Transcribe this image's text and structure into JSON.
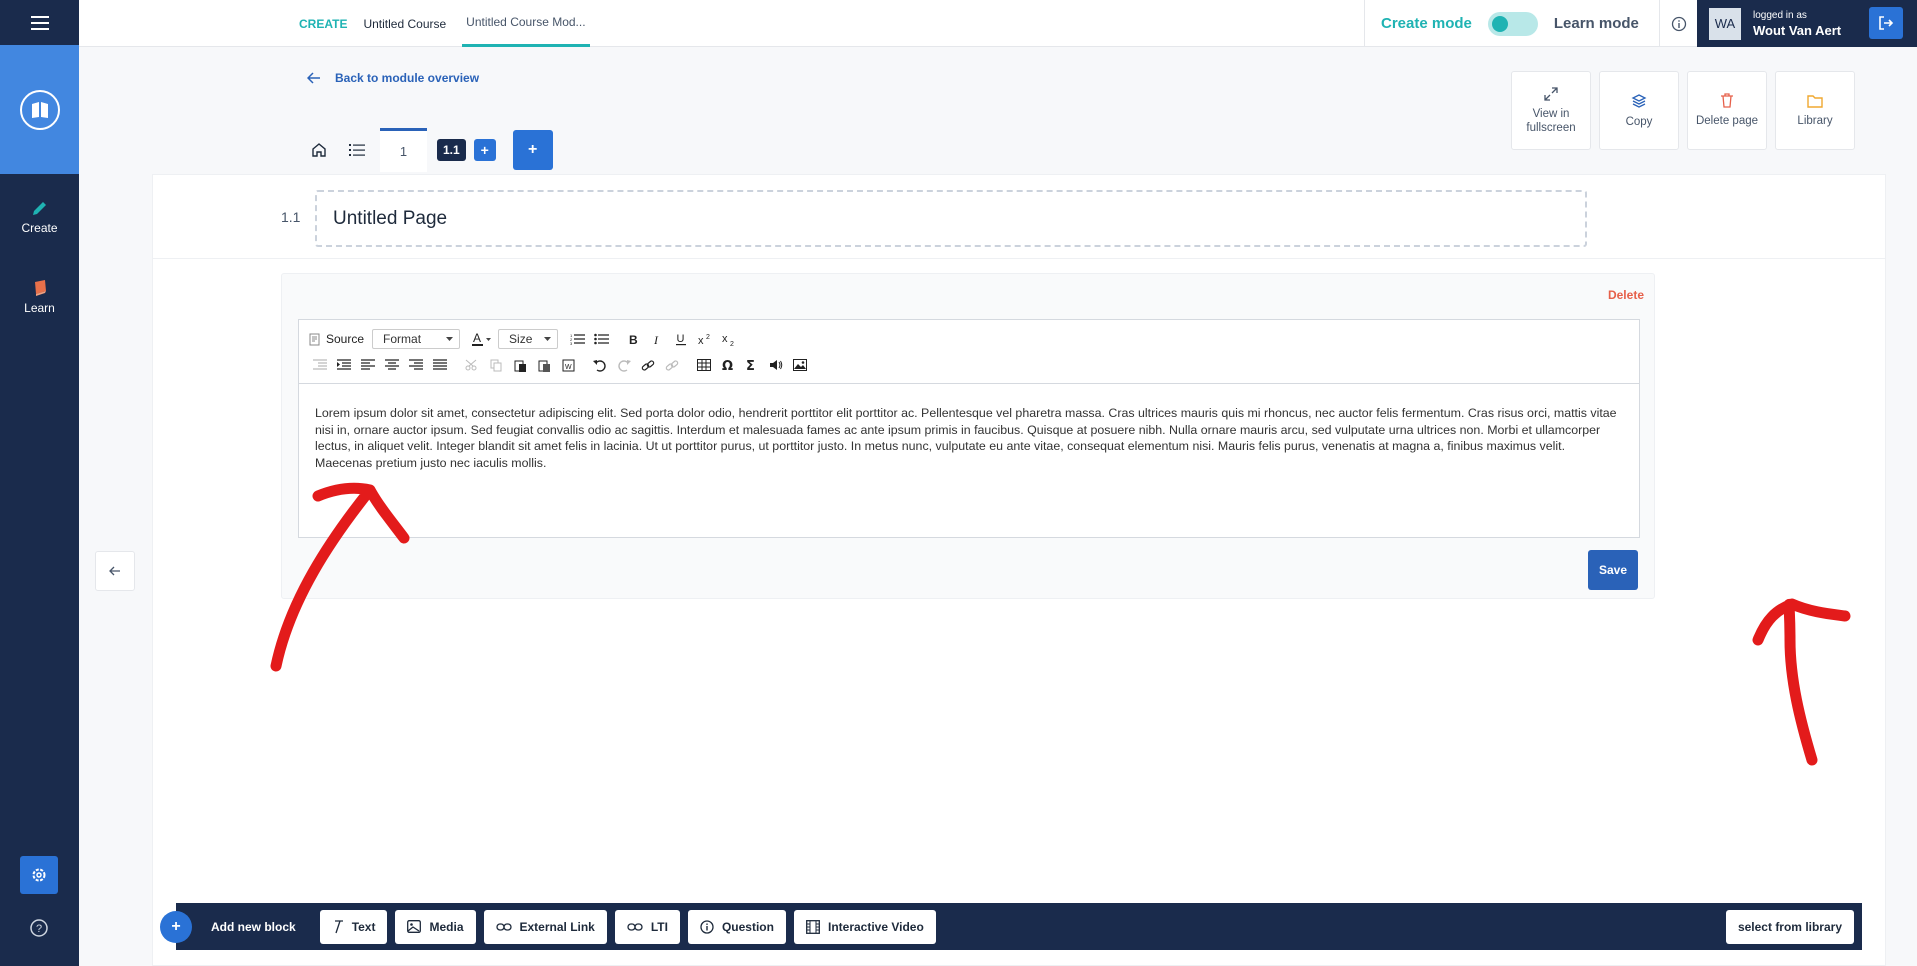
{
  "sidebar": {
    "items": [
      {
        "label": "Create",
        "icon": "pencil-icon"
      },
      {
        "label": "Learn",
        "icon": "book-icon"
      }
    ]
  },
  "topbar": {
    "breadcrumbs": [
      "CREATE",
      "Untitled Course",
      "Untitled Course Mod..."
    ],
    "mode_create": "Create mode",
    "mode_learn": "Learn mode",
    "user": {
      "initials": "WA",
      "caption": "logged in as",
      "name": "Wout Van Aert"
    }
  },
  "back_link": "Back to module overview",
  "actions": [
    {
      "label": "View in fullscreen",
      "icon": "expand-icon"
    },
    {
      "label": "Copy",
      "icon": "layers-icon"
    },
    {
      "label": "Delete page",
      "icon": "trash-icon"
    },
    {
      "label": "Library",
      "icon": "folder-icon"
    }
  ],
  "tabs": {
    "page": "1",
    "sub": "1.1",
    "plus": "+"
  },
  "page": {
    "number": "1.1",
    "title": "Untitled Page"
  },
  "block": {
    "delete_label": "Delete",
    "toolbar": {
      "source": "Source",
      "format": "Format",
      "size": "Size"
    },
    "body": "Lorem ipsum dolor sit amet, consectetur adipiscing elit. Sed porta dolor odio, hendrerit porttitor elit porttitor ac. Pellentesque vel pharetra massa. Cras ultrices mauris quis mi rhoncus, nec auctor felis fermentum. Cras risus orci, mattis vitae nisi in, ornare auctor ipsum. Sed feugiat convallis odio ac sagittis. Interdum et malesuada fames ac ante ipsum primis in faucibus. Quisque at posuere nibh. Nulla ornare mauris arcu, sed vulputate urna ultrices non. Morbi et ullamcorper lectus, in aliquet velit. Integer blandit sit amet felis in lacinia. Ut ut porttitor purus, ut porttitor justo. In metus nunc, vulputate eu ante vitae, consequat elementum nisi. Mauris felis purus, venenatis at magna a, finibus maximus velit. Maecenas pretium justo nec iaculis mollis.",
    "save_label": "Save"
  },
  "bottombar": {
    "plus": "+",
    "label": "Add new block",
    "buttons": [
      {
        "label": "Text",
        "icon": "text-icon"
      },
      {
        "label": "Media",
        "icon": "image-icon"
      },
      {
        "label": "External Link",
        "icon": "link-icon"
      },
      {
        "label": "LTI",
        "icon": "link-icon"
      },
      {
        "label": "Question",
        "icon": "info-icon"
      },
      {
        "label": "Interactive Video",
        "icon": "film-icon"
      }
    ],
    "library": "select from library"
  },
  "colors": {
    "navy": "#1a2b4c",
    "blue": "#2a72d6",
    "teal": "#1fb3b3",
    "annotation_red": "#e31b1b"
  }
}
